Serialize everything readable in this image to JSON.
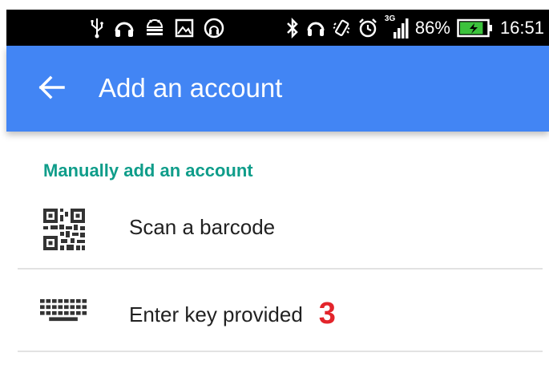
{
  "status_bar": {
    "left_icons": [
      "usb-icon",
      "headset-icon",
      "android-debug-icon",
      "image-icon",
      "headset-alt-icon"
    ],
    "right_icons": [
      "bluetooth-icon",
      "headset-icon",
      "vibrate-icon",
      "alarm-icon",
      "signal-3g-icon"
    ],
    "network_type": "3G",
    "battery_percent": "86%",
    "battery_level": 0.86,
    "time": "16:51"
  },
  "app_bar": {
    "title": "Add an account",
    "back_icon": "arrow-back-icon",
    "color": "#4285f4"
  },
  "section": {
    "header": "Manually add an account",
    "header_color": "#0f9d8a"
  },
  "items": [
    {
      "label": "Scan a barcode",
      "icon": "qr-code-icon"
    },
    {
      "label": "Enter key provided",
      "icon": "keyboard-icon",
      "badge": "3"
    }
  ],
  "colors": {
    "badge": "#e3242b",
    "battery": "#3cc23c"
  }
}
